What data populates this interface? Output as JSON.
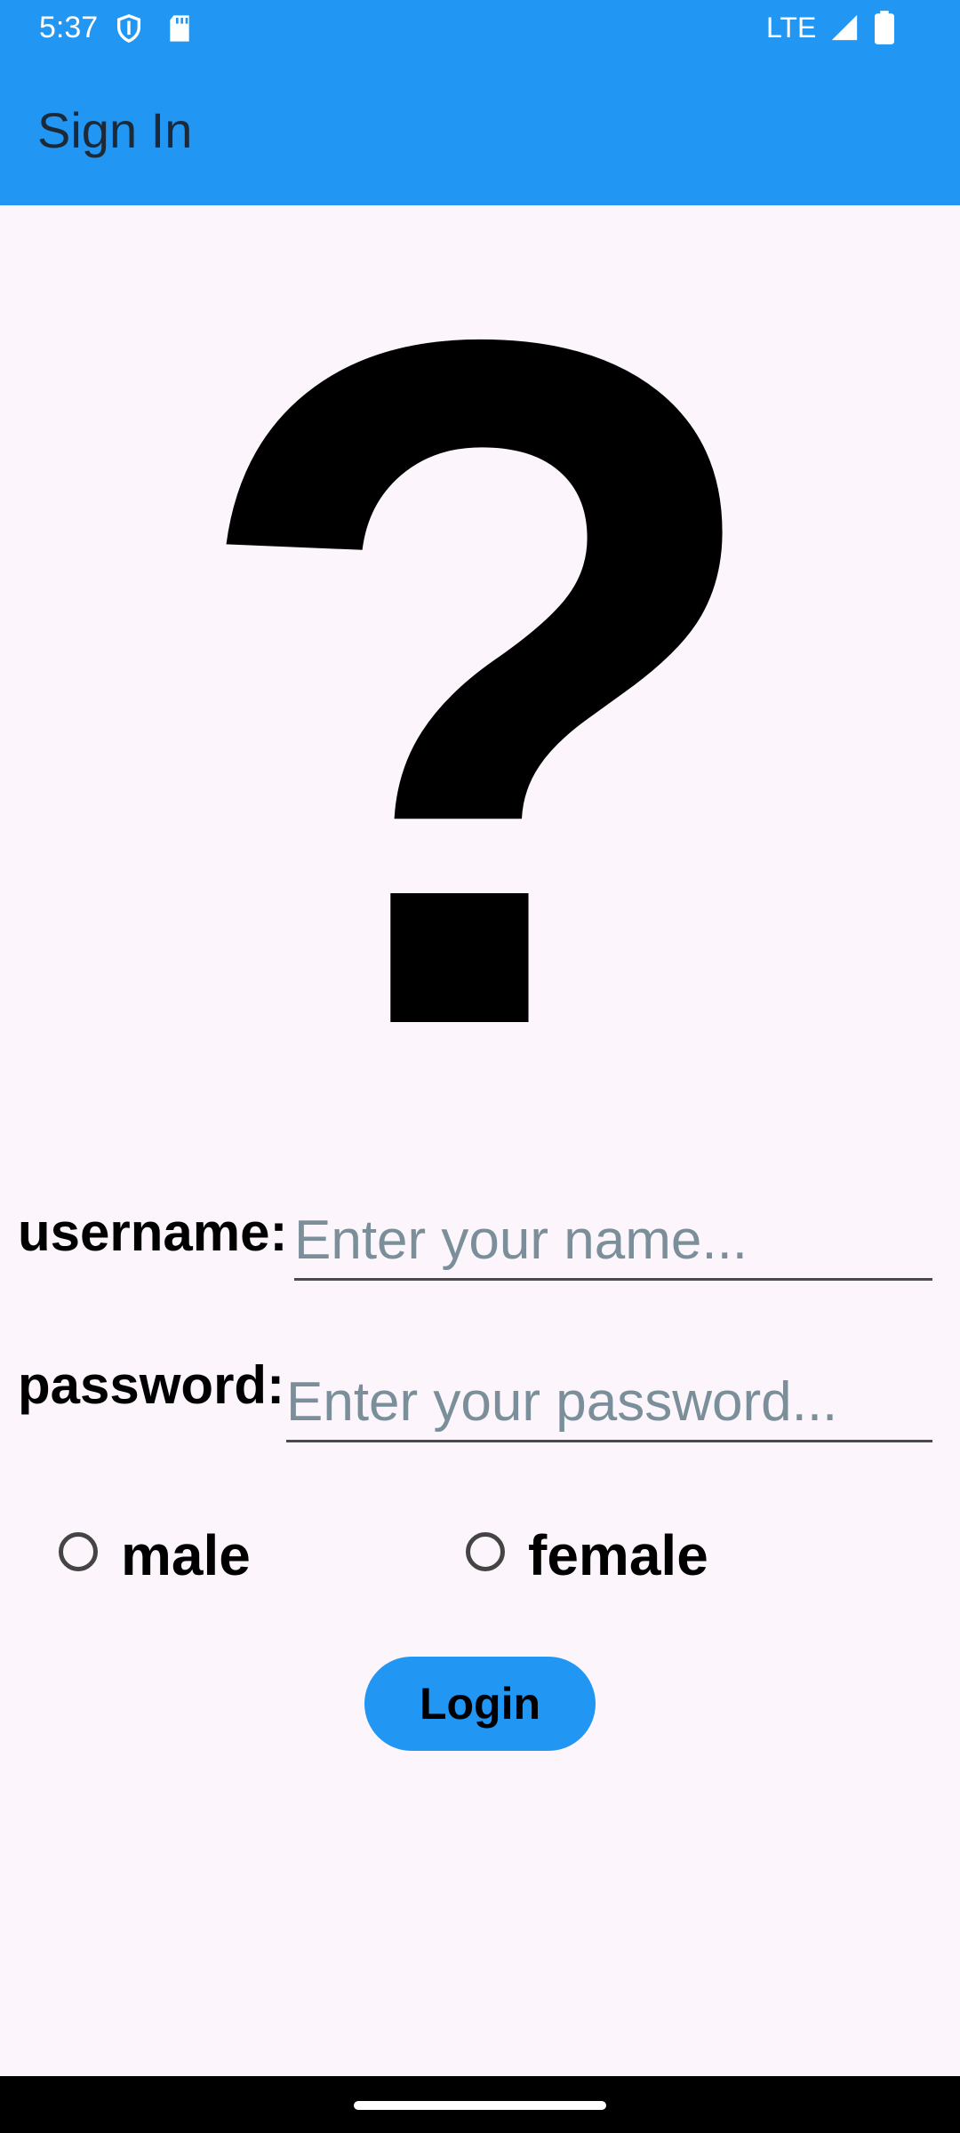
{
  "status_bar": {
    "time": "5:37",
    "network": "LTE",
    "icons": [
      "shield-icon",
      "sd-card-icon",
      "signal-icon",
      "battery-icon"
    ]
  },
  "app_bar": {
    "title": "Sign In",
    "color": "#2196f3"
  },
  "hero": {
    "glyph": "?",
    "icon": "question-mark-icon"
  },
  "form": {
    "username": {
      "label": "username:",
      "value": "",
      "placeholder": "Enter your name..."
    },
    "password": {
      "label": "password:",
      "value": "",
      "placeholder": "Enter your password..."
    },
    "gender": {
      "options": [
        {
          "label": "male",
          "selected": false
        },
        {
          "label": "female",
          "selected": false
        }
      ]
    },
    "login_label": "Login"
  },
  "colors": {
    "accent": "#2196f3",
    "background": "#fcf5fb",
    "placeholder": "#7a8f99"
  }
}
